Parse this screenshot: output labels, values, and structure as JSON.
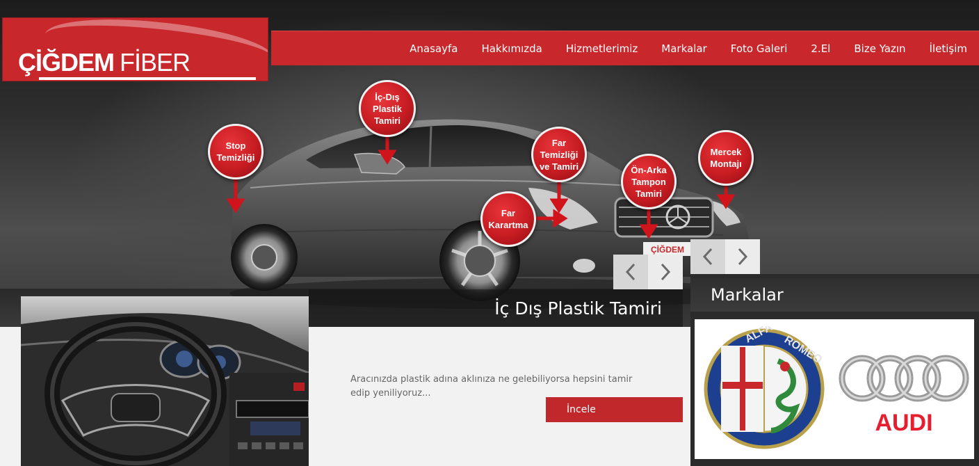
{
  "logo": {
    "word1": "ÇİĞDEM",
    "word2": "FİBER"
  },
  "nav": {
    "items": [
      "Anasayfa",
      "Hakkımızda",
      "Hizmetlerimiz",
      "Markalar",
      "Foto Galeri",
      "2.El",
      "Bize Yazın",
      "İletişim"
    ]
  },
  "hero": {
    "callouts": {
      "stop": "Stop\nTemizliği",
      "ic_dis": "İç-Dış\nPlastik\nTamiri",
      "far_temizligi": "Far\nTemizliği\nve Tamiri",
      "far_karartma": "Far\nKarartma",
      "on_arka": "Ön-Arka\nTampon\nTamiri",
      "mercek": "Mercek\nMontajı"
    },
    "plate_text": "ÇİĞDEM",
    "caption": "İç Dış Plastik Tamiri"
  },
  "feature": {
    "description": "Aracınızda plastik adına aklınıza ne gelebiliyorsa hepsini tamir edip yeniliyoruz...",
    "button_label": "İncele"
  },
  "brands": {
    "title": "Markalar",
    "alfa": {
      "top": "ALFA",
      "right": "ROMEO"
    },
    "audi": "AUDI"
  },
  "colors": {
    "brand_red": "#c8272c",
    "button_red": "#c0282b",
    "audi_red": "#e51f30",
    "alfa_blue": "#1d3f8f"
  },
  "icons": {
    "prev": "chevron-left-icon",
    "next": "chevron-right-icon"
  }
}
